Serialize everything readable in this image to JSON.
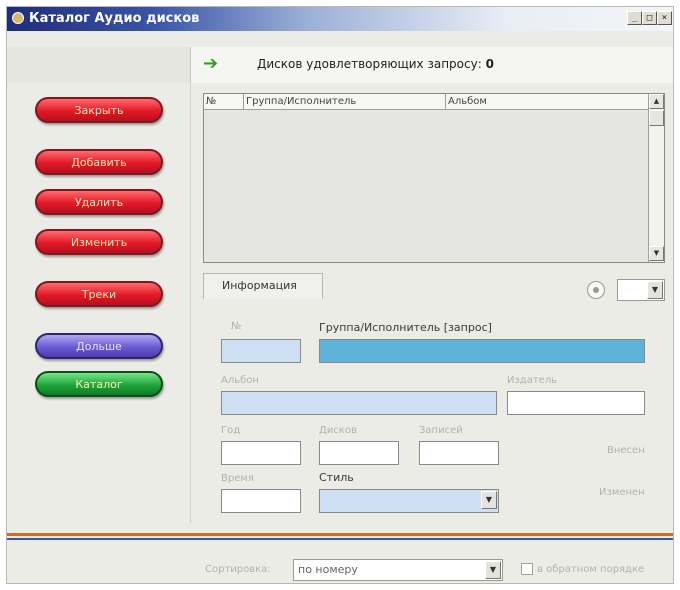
{
  "window": {
    "title": "Каталог Аудио дисков",
    "min": "_",
    "max": "□",
    "close": "×"
  },
  "search": {
    "count_label": "Дисков удовлетворяющих запросу:",
    "count_value": "0"
  },
  "sidebar": {
    "buttons": [
      "Закрыть",
      "Добавить",
      "Удалить",
      "Изменить",
      "Треки",
      "Дольше",
      "Каталог"
    ]
  },
  "grid": {
    "columns": [
      "№",
      "Группа/Исполнитель",
      "Альбом"
    ],
    "rows": []
  },
  "tab": {
    "label": "Информация"
  },
  "form": {
    "num_label": "№",
    "group_label": "Группа/Исполнитель [запрос]",
    "album_label": "Альбон",
    "publisher_label": "Издатель",
    "year_label": "Год",
    "discs_label": "Дисков",
    "records_label": "Записей",
    "entered_label": "Внесен",
    "time_label": "Время",
    "style_label": "Стиль",
    "changed_label": "Изменен"
  },
  "bottom": {
    "sort_label": "Сортировка:",
    "sort_value": "по номеру",
    "reverse_label": "в обратном порядке"
  },
  "icons": {
    "arrow": "green-arrow-right-icon",
    "app": "disc-icon"
  }
}
